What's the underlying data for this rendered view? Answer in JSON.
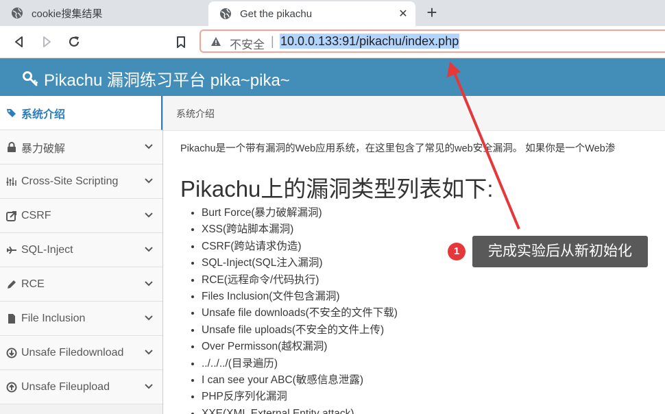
{
  "browser": {
    "tabs": [
      {
        "title": "cookie搜集结果",
        "active": false
      },
      {
        "title": "Get the pikachu",
        "active": true
      }
    ],
    "new_tab_label": "+",
    "close_glyph": "✕",
    "address": {
      "security_label": "不安全",
      "separator": "|",
      "url": "10.0.0.133:91/pikachu/index.php"
    }
  },
  "header": {
    "title": "Pikachu 漏洞练习平台 pika~pika~",
    "bg_color": "#438eb9"
  },
  "sidebar": {
    "items": [
      {
        "label": "系统介绍",
        "icon": "tags-icon",
        "active": true
      },
      {
        "label": "暴力破解",
        "icon": "lock-icon"
      },
      {
        "label": "Cross-Site Scripting",
        "icon": "sliders-icon"
      },
      {
        "label": "CSRF",
        "icon": "share-icon"
      },
      {
        "label": "SQL-Inject",
        "icon": "plane-icon"
      },
      {
        "label": "RCE",
        "icon": "pencil-icon"
      },
      {
        "label": "File Inclusion",
        "icon": "file-icon"
      },
      {
        "label": "Unsafe Filedownload",
        "icon": "download-icon"
      },
      {
        "label": "Unsafe Fileupload",
        "icon": "upload-icon"
      }
    ]
  },
  "breadcrumb": "系统介绍",
  "content": {
    "intro": "Pikachu是一个带有漏洞的Web应用系统，在这里包含了常见的web安全漏洞。 如果你是一个Web渗",
    "heading": "Pikachu上的漏洞类型列表如下:",
    "vulns": [
      "Burt Force(暴力破解漏洞)",
      "XSS(跨站脚本漏洞)",
      "CSRF(跨站请求伪造)",
      "SQL-Inject(SQL注入漏洞)",
      "RCE(远程命令/代码执行)",
      "Files Inclusion(文件包含漏洞)",
      "Unsafe file downloads(不安全的文件下载)",
      "Unsafe file uploads(不安全的文件上传)",
      "Over Permisson(越权漏洞)",
      "../../../(目录遍历)",
      "I can see your ABC(敏感信息泄露)",
      "PHP反序列化漏洞",
      "XXE(XML External Entity attack)"
    ]
  },
  "annotation": {
    "badge": "1",
    "text": "完成实验后从新初始化",
    "arrow_color": "#e5383b"
  }
}
